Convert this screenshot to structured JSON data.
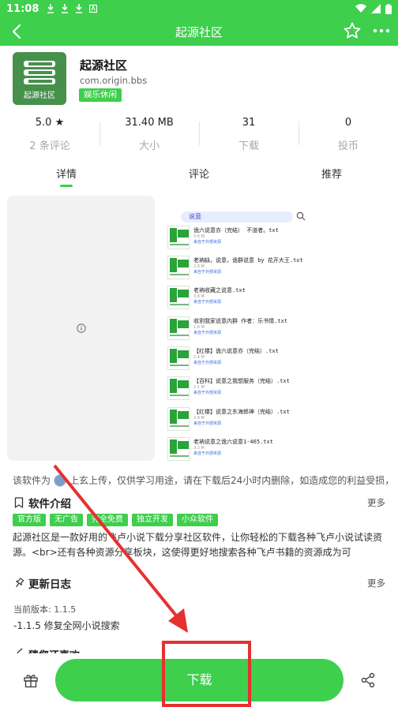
{
  "status_bar": {
    "time": "11:08",
    "icons": [
      "download-icon",
      "download-icon",
      "download-icon",
      "app-a-icon"
    ],
    "right_icons": [
      "wifi-icon",
      "signal-icon",
      "battery-icon"
    ]
  },
  "topbar": {
    "title": "起源社区",
    "color": "#3ecf4c"
  },
  "app": {
    "icon_text": "起源社区",
    "name": "起源社区",
    "package": "com.origin.bbs",
    "category": "娱乐休闲"
  },
  "stats": [
    {
      "value": "5.0 ★",
      "label": "2 条评论"
    },
    {
      "value": "31.40 MB",
      "label": "大小"
    },
    {
      "value": "31",
      "label": "下载"
    },
    {
      "value": "0",
      "label": "投币"
    }
  ],
  "tabs": [
    {
      "label": "详情",
      "active": true
    },
    {
      "label": "评论",
      "active": false
    },
    {
      "label": "推荐",
      "active": false
    }
  ],
  "screenshot": {
    "search_text": "说意",
    "books": [
      {
        "title": "诡六说意亦（完结）  不道者。txt",
        "size": "3.8 M",
        "tag": "来自于外部资源"
      },
      {
        "title": "老衲缺，说意，诡群说意 by 花开大王.txt",
        "size": "2.8 M",
        "tag": "来自于外部资源"
      },
      {
        "title": "老衲收藏之说意.txt",
        "size": "3.8 M",
        "tag": "来自于外部资源"
      },
      {
        "title": "收割我家说意内群 作者：乐书情.txt",
        "size": "1.8 M",
        "tag": "来自于外部资源"
      },
      {
        "title": "【红楼】诡六说意亦（完结）.txt",
        "size": "2.4 M",
        "tag": "来自于外部资源"
      },
      {
        "title": "【百科】说意之我想服务（完结）.txt",
        "size": "2.1 M",
        "tag": "来自于外部资源"
      },
      {
        "title": "【红楼】说意之东海郎神（完结）.txt",
        "size": "2.9 M",
        "tag": "来自于外部资源"
      },
      {
        "title": "老衲说意之诡六说意1-465.txt",
        "size": "3.3 M",
        "tag": "来自于外部资源"
      }
    ]
  },
  "upload": {
    "prefix": "该软件为",
    "uploader": "上玄",
    "suffix": "上传，仅供学习用途，请在下载后24小时内删除，如造成您的利益受损，"
  },
  "intro": {
    "title": "软件介绍",
    "more": "更多",
    "tags": [
      "官方版",
      "无广告",
      "完全免费",
      "独立开发",
      "小众软件"
    ],
    "description": "起源社区是一款好用的飞卢小说下载分享社区软件，让你轻松的下载各种飞卢小说试读资源。<br>还有各种资源分享板块，这使得更好地搜索各种飞卢书籍的资源成为可"
  },
  "changelog": {
    "title": "更新日志",
    "more": "更多",
    "current_version": "当前版本: 1.1.5",
    "entry": "-1.1.5 修复全网小说搜索"
  },
  "recommend_peek": {
    "title": "猜您还喜欢"
  },
  "bottom": {
    "download_label": "下载"
  },
  "annotation": {
    "color": "#e53030"
  }
}
